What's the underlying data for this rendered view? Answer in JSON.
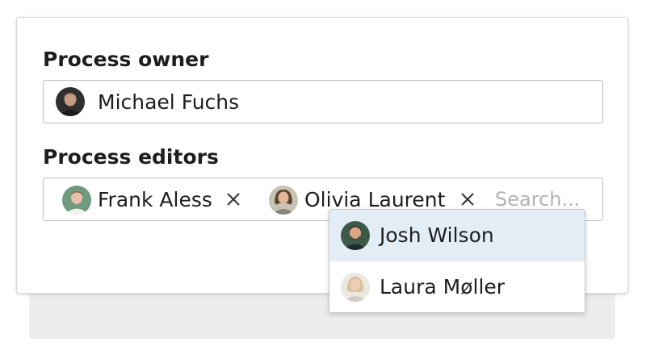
{
  "form": {
    "owner_label": "Process owner",
    "owner": {
      "name": "Michael Fuchs",
      "avatar_icon": "person-avatar-icon"
    },
    "editors_label": "Process editors",
    "editors": [
      {
        "name": "Frank Aless",
        "avatar_icon": "person-avatar-icon",
        "remove_icon": "close-icon"
      },
      {
        "name": "Olivia Laurent",
        "avatar_icon": "person-avatar-icon",
        "remove_icon": "close-icon"
      }
    ],
    "search": {
      "placeholder": "Search...",
      "value": ""
    }
  },
  "suggestions": [
    {
      "name": "Josh Wilson",
      "highlighted": true,
      "avatar_icon": "person-avatar-icon"
    },
    {
      "name": "Laura Møller",
      "highlighted": false,
      "avatar_icon": "person-avatar-icon"
    }
  ],
  "colors": {
    "border": "#bdbdbd",
    "highlight": "#e3edf5",
    "placeholder": "#b3b3b3",
    "text": "#1e1e1e",
    "back_panel": "#ececec"
  }
}
